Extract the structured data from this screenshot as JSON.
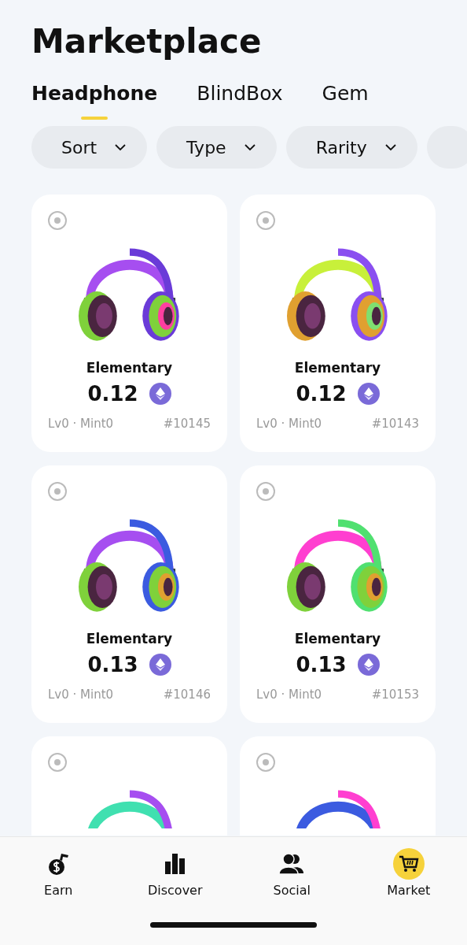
{
  "title": "Marketplace",
  "tabs": [
    {
      "label": "Headphone",
      "selected": true
    },
    {
      "label": "BlindBox",
      "selected": false
    },
    {
      "label": "Gem",
      "selected": false
    }
  ],
  "filters": [
    {
      "label": "Sort"
    },
    {
      "label": "Type"
    },
    {
      "label": "Rarity"
    }
  ],
  "items": [
    {
      "name": "Elementary",
      "price": "0.12",
      "meta": "Lv0 · Mint0",
      "number": "#10145"
    },
    {
      "name": "Elementary",
      "price": "0.12",
      "meta": "Lv0 · Mint0",
      "number": "#10143"
    },
    {
      "name": "Elementary",
      "price": "0.13",
      "meta": "Lv0 · Mint0",
      "number": "#10146"
    },
    {
      "name": "Elementary",
      "price": "0.13",
      "meta": "Lv0 · Mint0",
      "number": "#10153"
    },
    {
      "kind": "picture"
    },
    {
      "kind": "picture"
    }
  ],
  "nav": [
    {
      "kind": "earn",
      "label": "Earn",
      "selected": false
    },
    {
      "kind": "discover",
      "label": "Discover",
      "selected": false
    },
    {
      "kind": "social",
      "label": "Social",
      "selected": false
    },
    {
      "kind": "market",
      "label": "Market",
      "selected": true
    }
  ]
}
